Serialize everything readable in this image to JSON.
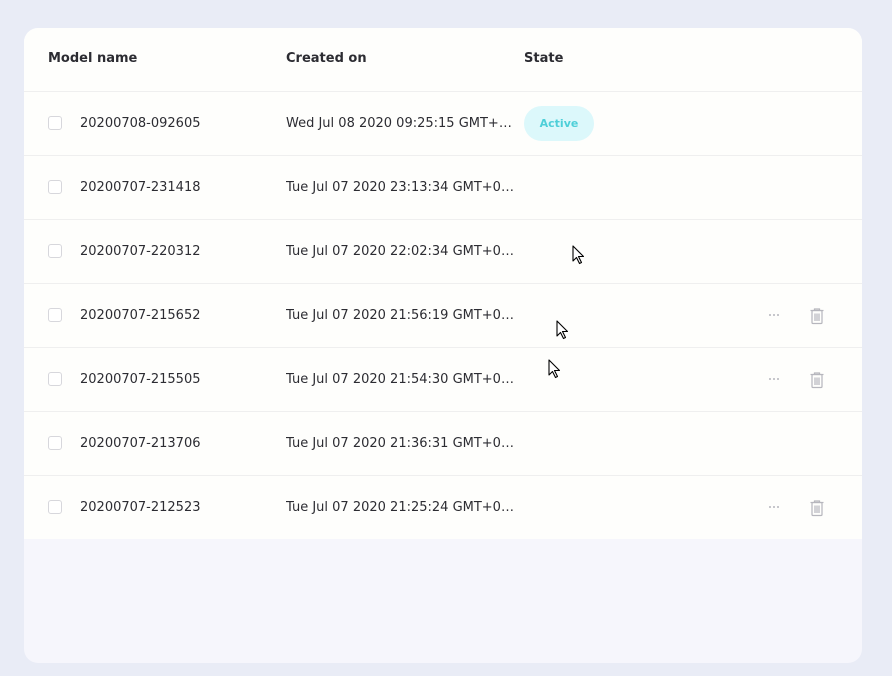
{
  "table": {
    "columns": {
      "model_name": "Model name",
      "created_on": "Created on",
      "state": "State"
    },
    "rows": [
      {
        "name": "20200708-092605",
        "created": "Wed Jul 08 2020 09:25:15 GMT+0...",
        "state": "Active",
        "actions": false
      },
      {
        "name": "20200707-231418",
        "created": "Tue Jul 07 2020 23:13:34 GMT+02...",
        "state": "",
        "actions": false
      },
      {
        "name": "20200707-220312",
        "created": "Tue Jul 07 2020 22:02:34 GMT+02...",
        "state": "",
        "actions": false
      },
      {
        "name": "20200707-215652",
        "created": "Tue Jul 07 2020 21:56:19 GMT+02...",
        "state": "",
        "actions": true
      },
      {
        "name": "20200707-215505",
        "created": "Tue Jul 07 2020 21:54:30 GMT+02...",
        "state": "",
        "actions": true
      },
      {
        "name": "20200707-213706",
        "created": "Tue Jul 07 2020 21:36:31 GMT+02...",
        "state": "",
        "actions": false
      },
      {
        "name": "20200707-212523",
        "created": "Tue Jul 07 2020 21:25:24 GMT+02...",
        "state": "",
        "actions": true
      }
    ]
  },
  "icons": {
    "more": "more-options-icon",
    "delete": "trash-icon",
    "cursor": "mouse-pointer-icon"
  },
  "colors": {
    "page_background": "#e9ecf6",
    "card_background": "#f6f6fc",
    "table_background": "#fefefc",
    "active_badge_bg": "#dcf8fb",
    "active_badge_text": "#4ecfd8",
    "text": "#2c2c32",
    "icon_gray": "#b6b6bd"
  }
}
